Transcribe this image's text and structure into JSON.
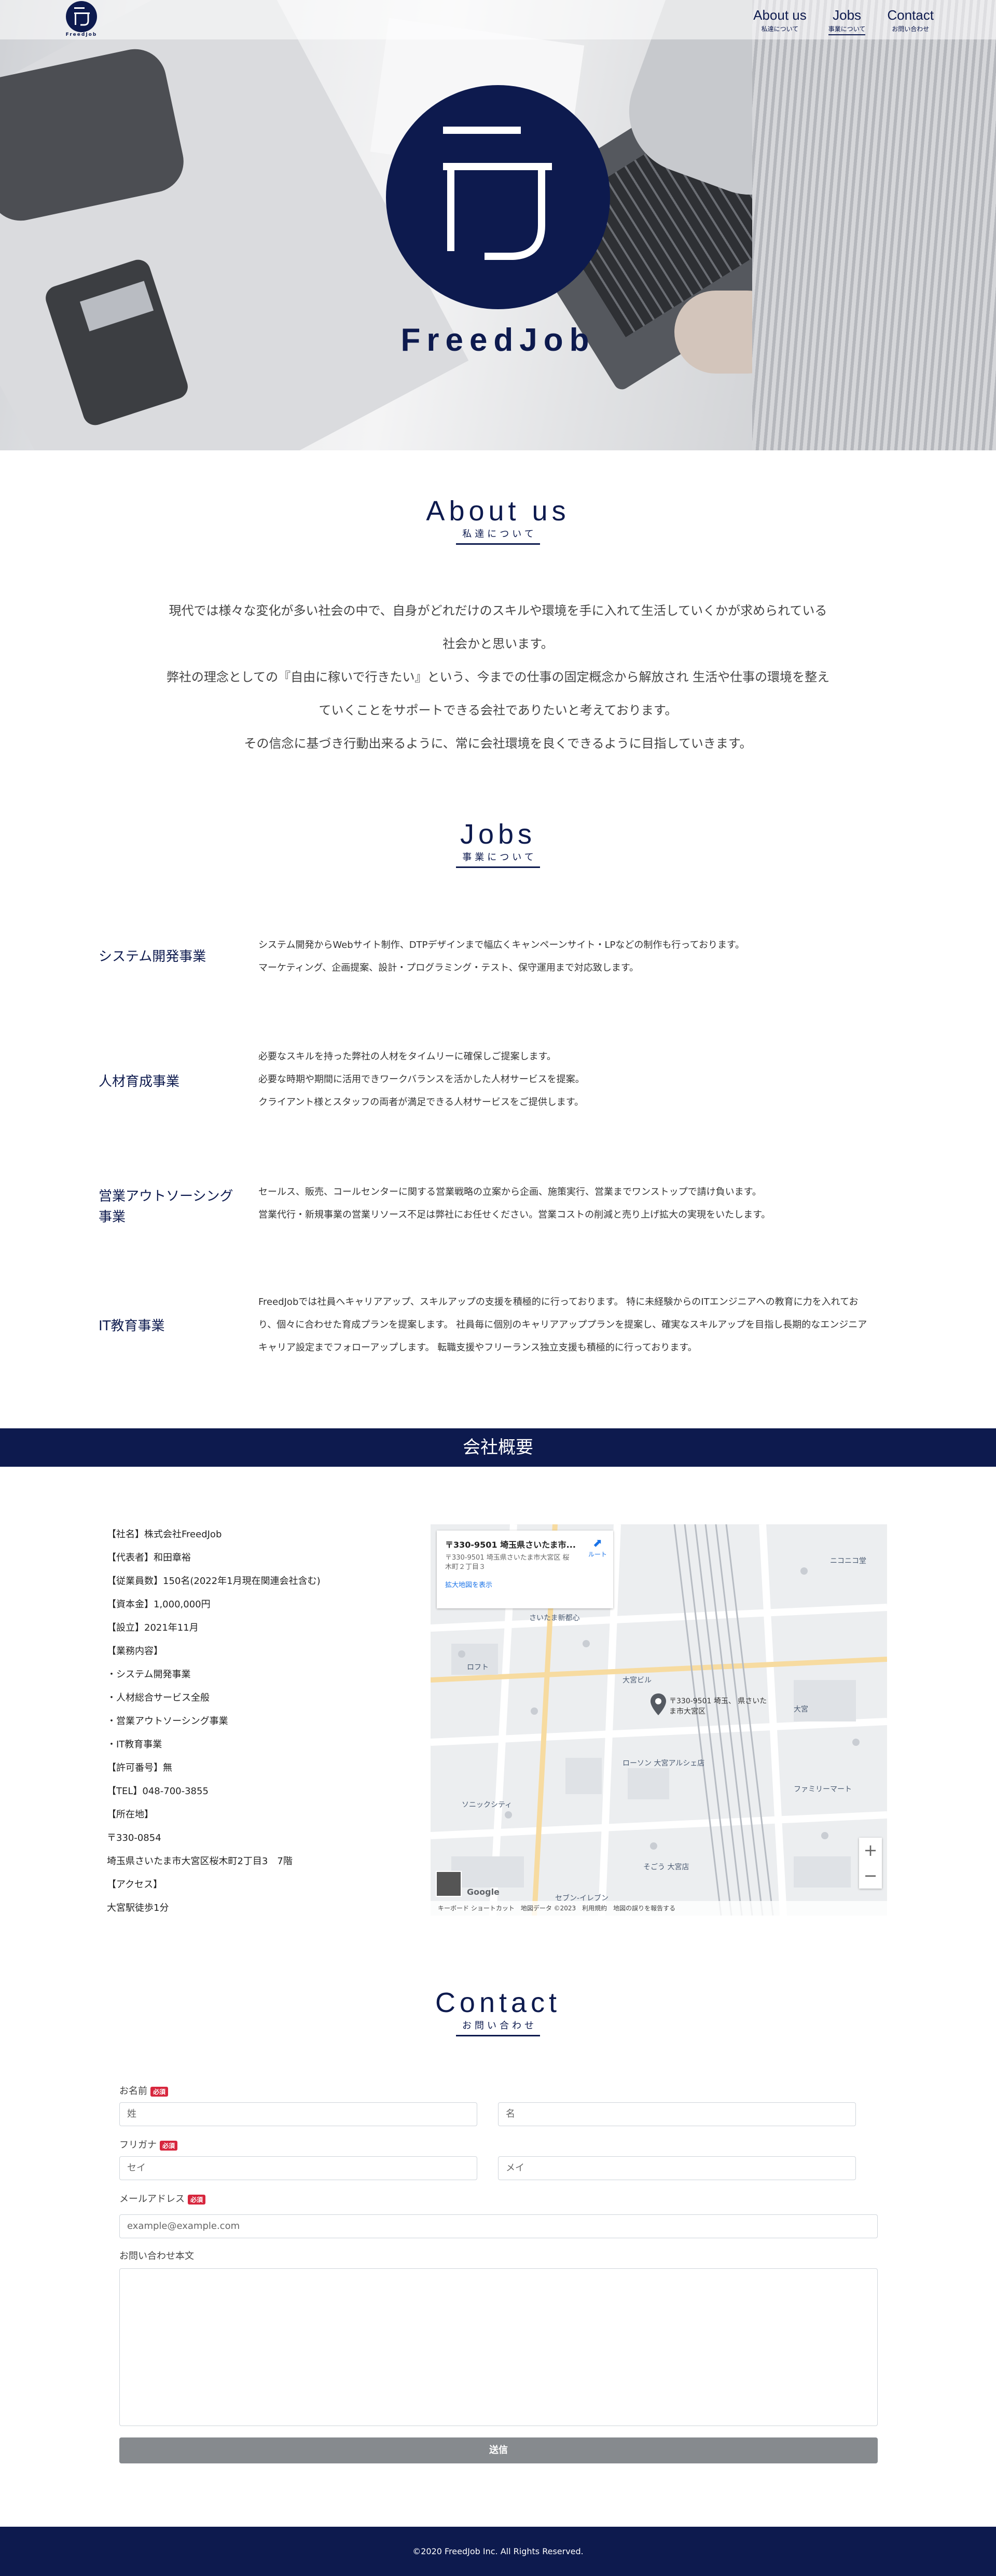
{
  "brand": {
    "small_logo_text": "FreedJob",
    "hero_name": "FreedJob",
    "navy": "#0d1a4e"
  },
  "nav": [
    {
      "en": "About us",
      "ja": "私達について"
    },
    {
      "en": "Jobs",
      "ja": "事業について"
    },
    {
      "en": "Contact",
      "ja": "お問い合わせ"
    }
  ],
  "about": {
    "title": "About us",
    "subtitle": "私達について",
    "lines": [
      "現代では様々な変化が多い社会の中で、自身がどれだけのスキルや環境を手に入れて生活していくかが求められている",
      "社会かと思います。",
      "弊社の理念としての『自由に稼いで行きたい』という、今までの仕事の固定概念から解放され 生活や仕事の環境を整え",
      "ていくことをサポートできる会社でありたいと考えております。",
      "その信念に基づき行動出来るように、常に会社環境を良くできるように目指していきます。"
    ]
  },
  "jobs": {
    "title": "Jobs",
    "subtitle": "事業について",
    "items": [
      {
        "title": "システム開発事業",
        "lines": [
          "システム開発からWebサイト制作、DTPデザインまで幅広くキャンペーンサイト・LPなどの制作も行っております。",
          "マーケティング、企画提案、設計・プログラミング・テスト、保守運用まで対応致します。"
        ]
      },
      {
        "title": "人材育成事業",
        "lines": [
          "必要なスキルを持った弊社の人材をタイムリーに確保しご提案します。",
          "必要な時期や期間に活用できワークバランスを活かした人材サービスを提案。",
          "クライアント様とスタッフの両者が満足できる人材サービスをご提供します。"
        ]
      },
      {
        "title": "営業アウトソーシング事業",
        "lines": [
          "セールス、販売、コールセンターに関する営業戦略の立案から企画、施策実行、営業までワンストップで請け負います。",
          "営業代行・新規事業の営業リソース不足は弊社にお任せください。営業コストの削減と売り上げ拡大の実現をいたします。"
        ]
      },
      {
        "title": "IT教育事業",
        "lines": [
          "FreedJobでは社員へキャリアアップ、スキルアップの支援を積極的に行っております。 特に未経験からのITエンジニアへの教育に力を入れてお",
          "り、個々に合わせた育成プランを提案します。 社員毎に個別のキャリアアッププランを提案し、確実なスキルアップを目指し長期的なエンジニア",
          "キャリア設定までフォローアップします。 転職支援やフリーランス独立支援も積極的に行っております。"
        ]
      }
    ]
  },
  "company": {
    "heading": "会社概要",
    "lines": [
      "【社名】株式会社FreedJob",
      "【代表者】和田章裕",
      "【従業員数】150名(2022年1月現在関連会社含む)",
      "【資本金】1,000,000円",
      "【設立】2021年11月",
      "【業務内容】",
      "・システム開発事業",
      "・人材総合サービス全般",
      "・営業アウトソーシング事業",
      "・IT教育事業",
      "【許可番号】無",
      "【TEL】048-700-3855",
      "【所在地】",
      "〒330-0854",
      "埼玉県さいたま市大宮区桜木町2丁目3　7階",
      "【アクセス】",
      "大宮駅徒歩1分"
    ]
  },
  "map": {
    "card_title": "〒330-9501 埼玉県さいたま市...",
    "card_address": "〒330-9501 埼玉県さいたま市大宮区 桜木町２丁目３",
    "route": "ルート",
    "larger_map": "拡大地図を表示",
    "pin_label": "〒330-9501 埼玉、 県さいたま市大宮区",
    "labels": [
      "さいたま新都心",
      "大宮",
      "ソニックシティ",
      "そごう 大宮店",
      "ローソン 大宮アルシェ店",
      "ファミリーマート",
      "セブン-イレブン",
      "ロフト",
      "大宮ビル",
      "ニコニコ堂"
    ],
    "google": "Google",
    "footer": "キーボード ショートカット　地図データ ©2023　利用規約　地図の誤りを報告する",
    "zoom_in": "+",
    "zoom_out": "−"
  },
  "contact": {
    "title": "Contact",
    "subtitle": "お問い合わせ",
    "required": "必須",
    "name_label": "お名前",
    "last_name_placeholder": "姓",
    "first_name_placeholder": "名",
    "kana_label": "フリガナ",
    "last_kana_placeholder": "セイ",
    "first_kana_placeholder": "メイ",
    "email_label": "メールアドレス",
    "email_placeholder": "example@example.com",
    "message_label": "お問い合わせ本文",
    "submit": "送信"
  },
  "footer": {
    "copyright": "©2020 FreedJob Inc. All Rights Reserved."
  }
}
